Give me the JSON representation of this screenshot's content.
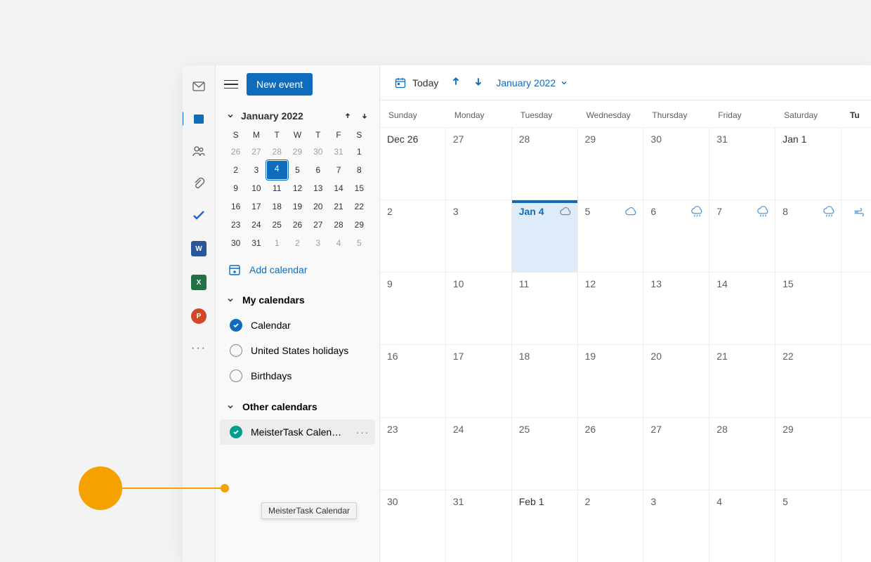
{
  "sidebar": {
    "new_event_label": "New event",
    "add_calendar_label": "Add calendar",
    "mini": {
      "title": "January 2022",
      "dow": [
        "S",
        "M",
        "T",
        "W",
        "T",
        "F",
        "S"
      ],
      "rows": [
        [
          {
            "n": "26",
            "m": true
          },
          {
            "n": "27",
            "m": true
          },
          {
            "n": "28",
            "m": true
          },
          {
            "n": "29",
            "m": true
          },
          {
            "n": "30",
            "m": true
          },
          {
            "n": "31",
            "m": true
          },
          {
            "n": "1"
          }
        ],
        [
          {
            "n": "2"
          },
          {
            "n": "3"
          },
          {
            "n": "4",
            "today": true
          },
          {
            "n": "5"
          },
          {
            "n": "6"
          },
          {
            "n": "7"
          },
          {
            "n": "8"
          }
        ],
        [
          {
            "n": "9"
          },
          {
            "n": "10"
          },
          {
            "n": "11"
          },
          {
            "n": "12"
          },
          {
            "n": "13"
          },
          {
            "n": "14"
          },
          {
            "n": "15"
          }
        ],
        [
          {
            "n": "16"
          },
          {
            "n": "17"
          },
          {
            "n": "18"
          },
          {
            "n": "19"
          },
          {
            "n": "20"
          },
          {
            "n": "21"
          },
          {
            "n": "22"
          }
        ],
        [
          {
            "n": "23"
          },
          {
            "n": "24"
          },
          {
            "n": "25"
          },
          {
            "n": "26"
          },
          {
            "n": "27"
          },
          {
            "n": "28"
          },
          {
            "n": "29"
          }
        ],
        [
          {
            "n": "30"
          },
          {
            "n": "31"
          },
          {
            "n": "1",
            "m": true
          },
          {
            "n": "2",
            "m": true
          },
          {
            "n": "3",
            "m": true
          },
          {
            "n": "4",
            "m": true
          },
          {
            "n": "5",
            "m": true
          }
        ]
      ]
    },
    "sections": {
      "my": {
        "title": "My calendars",
        "items": [
          {
            "label": "Calendar",
            "checked": true,
            "color": "blue"
          },
          {
            "label": "United States holidays",
            "checked": false
          },
          {
            "label": "Birthdays",
            "checked": false
          }
        ]
      },
      "other": {
        "title": "Other calendars",
        "items": [
          {
            "label": "MeisterTask Calen…",
            "checked": true,
            "color": "teal",
            "hover": true
          }
        ]
      }
    },
    "tooltip": "MeisterTask Calendar"
  },
  "toolbar": {
    "today_label": "Today",
    "month_label": "January 2022"
  },
  "grid": {
    "dow": [
      "Sunday",
      "Monday",
      "Tuesday",
      "Wednesday",
      "Thursday",
      "Friday",
      "Saturday"
    ],
    "extra_head": "Tu",
    "cells": [
      [
        "Dec 26",
        "27",
        "28",
        "29",
        "30",
        "31",
        "Jan 1",
        ""
      ],
      [
        "2",
        "3",
        "Jan 4",
        "5",
        "6",
        "7",
        "8",
        ""
      ],
      [
        "9",
        "10",
        "11",
        "12",
        "13",
        "14",
        "15",
        ""
      ],
      [
        "16",
        "17",
        "18",
        "19",
        "20",
        "21",
        "22",
        ""
      ],
      [
        "23",
        "24",
        "25",
        "26",
        "27",
        "28",
        "29",
        ""
      ],
      [
        "30",
        "31",
        "Feb 1",
        "2",
        "3",
        "4",
        "5",
        ""
      ]
    ],
    "today_index": [
      1,
      2
    ],
    "weather": [
      {
        "r": 1,
        "c": 2,
        "kind": "cloud",
        "gray": true
      },
      {
        "r": 1,
        "c": 3,
        "kind": "cloud"
      },
      {
        "r": 1,
        "c": 4,
        "kind": "rain"
      },
      {
        "r": 1,
        "c": 5,
        "kind": "rain"
      },
      {
        "r": 1,
        "c": 6,
        "kind": "rain"
      },
      {
        "r": 1,
        "c": 7,
        "kind": "wind"
      }
    ]
  }
}
